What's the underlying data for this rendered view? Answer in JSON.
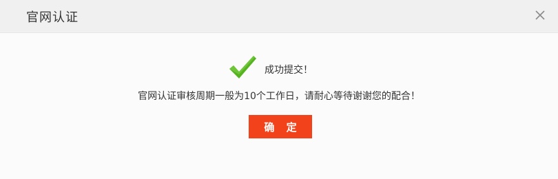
{
  "dialog": {
    "title": "官网认证",
    "close_icon": "close-icon",
    "success_icon": "check-icon",
    "success_text": "成功提交！",
    "message": "官网认证审核周期一般为10个工作日，请耐心等待谢谢您的配合！",
    "ok_label": "确 定"
  },
  "colors": {
    "titlebar_bg": "#f0f0f0",
    "button_bg": "#f2421b",
    "check_green": "#55b320"
  }
}
